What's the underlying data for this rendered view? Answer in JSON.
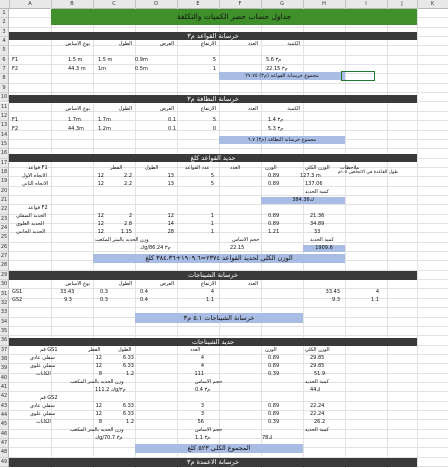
{
  "columns": [
    "A",
    "B",
    "C",
    "D",
    "E",
    "F",
    "G",
    "H",
    "I",
    "J",
    "K"
  ],
  "rows": [
    "1",
    "2",
    "3",
    "4",
    "5",
    "6",
    "7",
    "8",
    "9",
    "10",
    "11",
    "12",
    "13",
    "14",
    "15",
    "16",
    "17",
    "18",
    "19",
    "20",
    "21",
    "22",
    "23",
    "24",
    "25",
    "26",
    "27",
    "28",
    "29",
    "30",
    "31",
    "32",
    "33",
    "34",
    "35",
    "36",
    "37",
    "38",
    "39",
    "40",
    "41",
    "42",
    "43",
    "44",
    "45",
    "46",
    "47",
    "48",
    "49"
  ],
  "title": "جداول حساب حصر الكميات والتكلفة",
  "sec_footings": "خرسانة القواعد م٣",
  "ft_headers": {
    "type": "نوع الاساس",
    "len": "الطول",
    "width": "العرض",
    "height": "الارتفاع",
    "count": "العدد",
    "qty": "الكمية"
  },
  "ft_rows": [
    {
      "id": "F1",
      "len": "1.5 m",
      "width": "1.5 m",
      "height": "0.9m",
      "count": "5",
      "qty": "5.6 م٣"
    },
    {
      "id": "F2",
      "len": "44.3 m",
      "width": "1m",
      "height": "0.5m",
      "count": "1",
      "qty": "22.15 م٣"
    }
  ],
  "ft_total": "مجموع خرسانة القواعد (م٣) ٢٧.٧٥",
  "sec_lean": "خرسانة النظافة م٣",
  "lean_rows": [
    {
      "id": "F1",
      "len": "1.7m",
      "width": "1.7m",
      "height": "0.1",
      "count": "5",
      "qty": "1.4 م٣"
    },
    {
      "id": "F2",
      "len": "44.3m",
      "width": "1.2m",
      "height": "0.1",
      "count": "0",
      "qty": "5.3 م٣"
    }
  ],
  "lean_total": "مجموع خرسانة النظافة (م٣) ٦.٧",
  "sec_steel_ft": "حديد القواعد كلغ",
  "steel_headers": {
    "notes": "ملاحظات",
    "totalw": "الوزن الكلي",
    "w": "الوزن",
    "count": "العدد",
    "bars": "عدد القواعد",
    "len": "الطول",
    "dia": "القطر",
    "type": "قواعد F1"
  },
  "steel_f1": [
    {
      "name": "الاتجاه الأول",
      "dia": "12",
      "len": "2.2",
      "bars": "13",
      "count": "5",
      "w": "0.89",
      "totalw": "127.3 m"
    },
    {
      "name": "الاتجاه الثاني",
      "dia": "12",
      "len": "2.2",
      "bars": "13",
      "count": "5",
      "w": "0.89",
      "totalw": "137.06"
    }
  ],
  "steel_note": "طول القاعدة في الاتجاهين ١.٥م",
  "steel_f1_total_label": "كمية الحديد",
  "steel_f1_total": "ك384.36",
  "steel_f2_type": "قواعد F2",
  "steel_f2": [
    {
      "name": "الحديد السفلي",
      "dia": "12",
      "len": "2",
      "bars": "12",
      "count": "1",
      "w": "0.89",
      "totalw": "21.36"
    },
    {
      "name": "الحديد العلوي",
      "dia": "12",
      "len": "2.8",
      "bars": "14",
      "count": "1",
      "w": "0.89",
      "totalw": "34.89"
    },
    {
      "name": "الحديد الجانبي",
      "dia": "12",
      "len": "1.15",
      "bars": "28",
      "count": "1",
      "w": "1.21",
      "totalw": "33"
    }
  ],
  "steel_f2_conc_label": "وزن الحديد بالمتر المكعب",
  "steel_f2_vol_label": "حجم الاساس",
  "steel_f2_qty_label": "كمية الحديد",
  "steel_f2_vals": {
    "a": "كg/م٣ 86.24",
    "b": "22.15",
    "c": "1909.6"
  },
  "steel_ft_total": "الوزن الكلي لحديد القواعد ٢٣٧٤=١٩٠٩.٦+٣٨٤.٣٦ كلغ",
  "sec_necks": "خرسانة الشيناجات",
  "neck_rows": [
    {
      "id": "GS1",
      "len": "33.43",
      "width": "0.3",
      "height": "0.4",
      "count": "4",
      "qty": "33.43",
      "extra": "4"
    },
    {
      "id": "GS2",
      "len": "9.3",
      "width": "0.3",
      "height": "0.4",
      "count": "1.1",
      "qty": "9.3",
      "extra": "1.1"
    }
  ],
  "neck_total": "خرسانة الشيناجات ٥.١ م٣",
  "sec_neck_steel": "حديد الشيناجات",
  "gs1_label": "قم GS1",
  "gs1_rows": [
    {
      "name": "سفلي عادي",
      "dia": "12",
      "len": "6.33",
      "count": "4",
      "w": "0.89",
      "totalw": "29.85"
    },
    {
      "name": "سفلي علوي",
      "dia": "12",
      "len": "6.33",
      "count": "4",
      "w": "0.89",
      "totalw": "29.85"
    },
    {
      "name": "الكانات",
      "dia": "8",
      "len": "1.2",
      "count": "111",
      "w": "0.39",
      "totalw": "51.9"
    }
  ],
  "gs1_vals": {
    "a": "111.2 كg/م٣",
    "b": "0.4 م٣",
    "c": "ك44"
  },
  "gs2_label": "قم GS2",
  "gs2_rows": [
    {
      "name": "سفلي عادي",
      "dia": "12",
      "len": "6.33",
      "count": "3",
      "w": "0.89",
      "totalw": "22.24"
    },
    {
      "name": "سفلي علوي",
      "dia": "12",
      "len": "6.33",
      "count": "3",
      "w": "0.89",
      "totalw": "22.24"
    },
    {
      "name": "الكانات",
      "dia": "8",
      "len": "1.2",
      "count": "56",
      "w": "0.39",
      "totalw": "26.2"
    }
  ],
  "gs2_vals": {
    "a": "كg/م٣ 70.7",
    "b": "1.1 م٣",
    "c": "ك78"
  },
  "neck_steel_total": "المجموع الكلي ٥٢٣ كلغ",
  "sec_columns": "خرسانة الاعمدة م٣"
}
